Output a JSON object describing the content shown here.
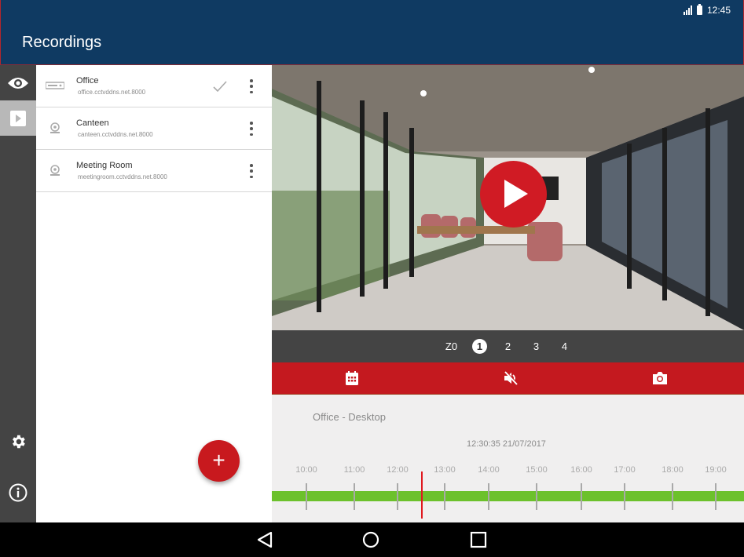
{
  "status_bar": {
    "time": "12:45",
    "signal_icon": "signal-icon",
    "battery_icon": "battery-icon"
  },
  "app_bar": {
    "title": "Recordings"
  },
  "rail": {
    "items": [
      {
        "name": "live-view",
        "icon": "eye-icon",
        "active": false
      },
      {
        "name": "recordings",
        "icon": "play-square-icon",
        "active": true
      },
      {
        "name": "settings",
        "icon": "gear-icon",
        "active": false
      },
      {
        "name": "info",
        "icon": "info-icon",
        "active": false
      }
    ]
  },
  "devices": [
    {
      "name": "Office",
      "host": "office.cctvddns.net.8000",
      "type": "dvr-icon",
      "selected": true
    },
    {
      "name": "Canteen",
      "host": "canteen.cctvddns.net.8000",
      "type": "camera-icon",
      "selected": false
    },
    {
      "name": "Meeting Room",
      "host": "meetingroom.cctvddns.net.8000",
      "type": "camera-icon",
      "selected": false
    }
  ],
  "fab": {
    "label": "+"
  },
  "channels": {
    "zoom_label": "Z0",
    "items": [
      "1",
      "2",
      "3",
      "4"
    ],
    "selected": "1"
  },
  "actions": {
    "calendar": "calendar-icon",
    "mute": "volume-off-icon",
    "snapshot": "camera-icon"
  },
  "timeline": {
    "source": "Office - Desktop",
    "timestamp": "12:30:35   21/07/2017",
    "hours": [
      "10:00",
      "11:00",
      "12:00",
      "13:00",
      "14:00",
      "15:00",
      "16:00",
      "17:00",
      "18:00",
      "19:00"
    ],
    "current_time": "12:30:35",
    "recording_color": "#6cc12c",
    "cursor_color": "#e0191f"
  },
  "colors": {
    "app_bar": "#0f3a62",
    "accent": "#c4191f",
    "rail": "#444444"
  }
}
